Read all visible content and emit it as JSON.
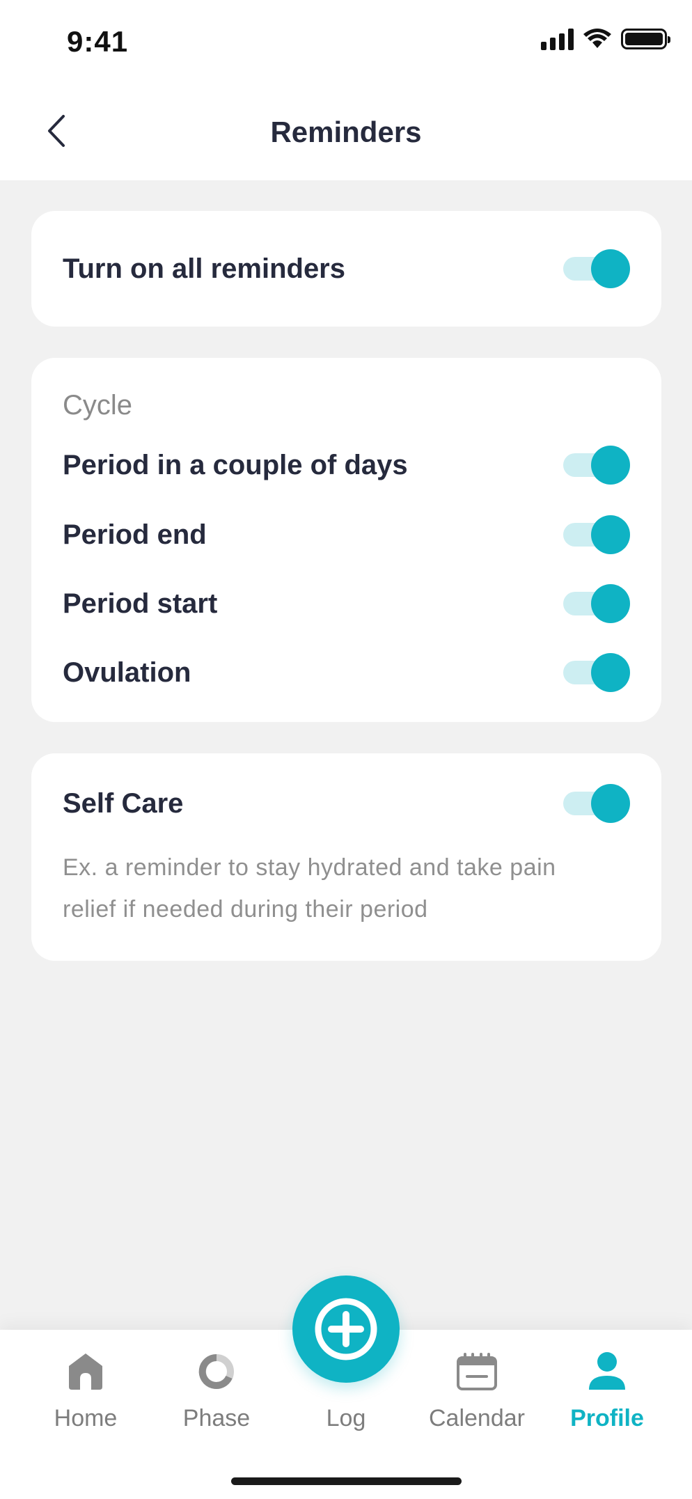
{
  "status_bar": {
    "time": "9:41"
  },
  "header": {
    "title": "Reminders",
    "back_icon": "chevron-left-icon"
  },
  "all_reminders": {
    "label": "Turn on all reminders",
    "enabled": true
  },
  "cycle": {
    "title": "Cycle",
    "items": [
      {
        "label": "Period in a couple of days",
        "enabled": true
      },
      {
        "label": "Period end",
        "enabled": true
      },
      {
        "label": "Period start",
        "enabled": true
      },
      {
        "label": "Ovulation",
        "enabled": true
      }
    ]
  },
  "self_care": {
    "label": "Self Care",
    "enabled": true,
    "description": "Ex. a reminder to stay hydrated and take pain relief if needed during their period"
  },
  "tabbar": {
    "tabs": [
      {
        "label": "Home",
        "icon": "home-icon",
        "active": false
      },
      {
        "label": "Phase",
        "icon": "phase-icon",
        "active": false
      },
      {
        "label": "Log",
        "icon": "plus-circle-icon",
        "active": false
      },
      {
        "label": "Calendar",
        "icon": "calendar-icon",
        "active": false
      },
      {
        "label": "Profile",
        "icon": "profile-icon",
        "active": true
      }
    ]
  },
  "colors": {
    "accent": "#0fb3c4",
    "accent_light": "#cdeef2",
    "text_dark": "#262a3d",
    "text_muted": "#8a8a8a",
    "background": "#f1f1f1"
  }
}
